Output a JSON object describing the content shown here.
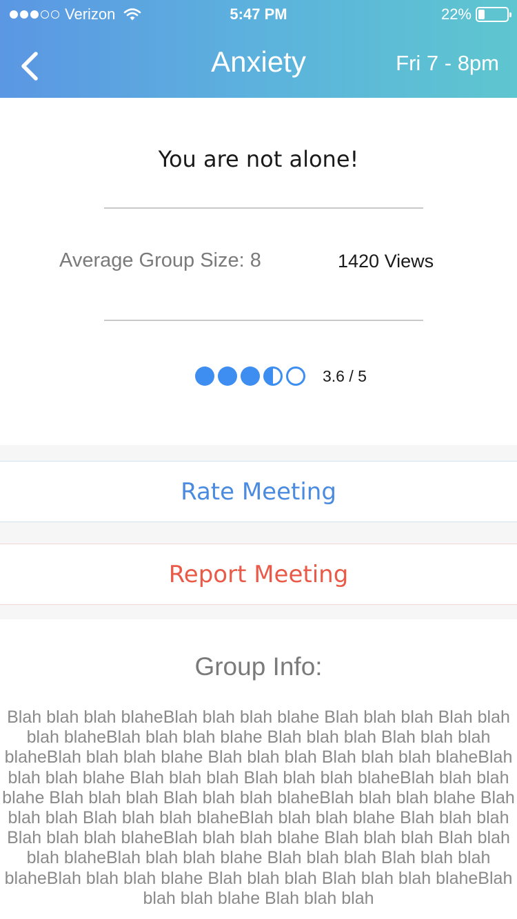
{
  "status_bar": {
    "carrier": "Verizon",
    "time": "5:47 PM",
    "battery": "22%",
    "battery_level": 0.22
  },
  "nav": {
    "back_icon": "chevron-left-icon",
    "title": "Anxiety",
    "schedule": "Fri 7 - 8pm"
  },
  "summary": {
    "tagline": "You are not alone!",
    "group_size": "Average Group Size: 8",
    "views": "1420 Views",
    "rating_value": 3.6,
    "rating_max": 5,
    "rating_text": "3.6 / 5"
  },
  "actions": {
    "rate_label": "Rate Meeting",
    "report_label": "Report Meeting"
  },
  "group_info": {
    "title": "Group Info:",
    "body": "Blah blah blah blaheBlah blah blah blahe Blah blah blah Blah blah blah blaheBlah blah blah blahe Blah blah blah Blah blah blah blaheBlah blah blah blahe Blah blah blah Blah blah blah blaheBlah blah blah blahe Blah blah blah Blah blah blah blaheBlah blah blah blahe Blah blah blah Blah blah blah blaheBlah blah blah blahe Blah blah blah Blah blah blah blaheBlah blah blah blahe Blah blah blah Blah blah blah blaheBlah blah blah blahe Blah blah blah Blah blah blah blaheBlah blah blah blahe Blah blah blah Blah blah blah blaheBlah blah blah blahe Blah blah blah Blah blah blah blaheBlah blah blah blahe Blah blah blah"
  },
  "colors": {
    "accent_blue": "#3d8ef0",
    "rate_blue": "#4a8be0",
    "report_red": "#ea5a48",
    "header_start": "#5b97e3",
    "header_end": "#5ec6cf"
  }
}
